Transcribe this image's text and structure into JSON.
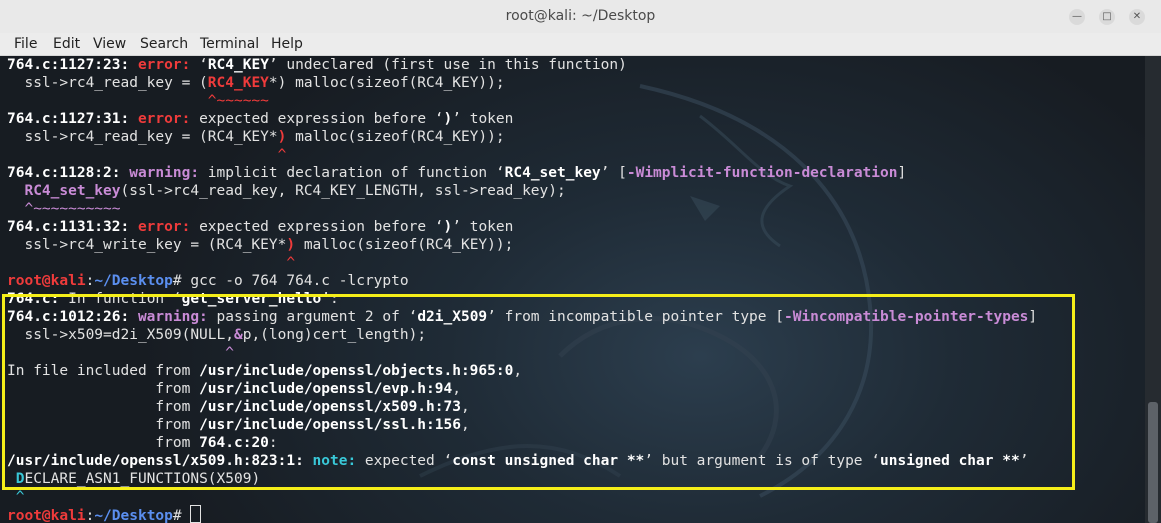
{
  "window": {
    "title": "root@kali: ~/Desktop",
    "minimize_icon": "minimize-icon",
    "maximize_icon": "maximize-icon",
    "close_icon": "close-icon"
  },
  "menu": [
    "File",
    "Edit",
    "View",
    "Search",
    "Terminal",
    "Help"
  ],
  "terminal": {
    "l1": {
      "loc": "764.c:1127:23:",
      "kind": "error:",
      "msg_a": " ‘",
      "sym": "RC4_KEY",
      "msg_b": "’ undeclared (first use in this function)"
    },
    "l2": {
      "a": "  ssl->rc4_read_key = (",
      "red": "RC4_KEY",
      "b": "*) malloc(sizeof(RC4_KEY));"
    },
    "l3": {
      "caret": "                       ^~~~~~~"
    },
    "l5": {
      "loc": "764.c:1127:31:",
      "kind": "error:",
      "msg_a": " expected expression before ‘",
      "sym": ")",
      "msg_b": "’ token"
    },
    "l6": {
      "a": "  ssl->rc4_read_key = (RC4_KEY*",
      "red": ")",
      "b": " malloc(sizeof(RC4_KEY));"
    },
    "l7": {
      "caret": "                               ^"
    },
    "l9": {
      "loc": "764.c:1128:2:",
      "kind": "warning:",
      "msg_a": " implicit declaration of function ‘",
      "sym": "RC4_set_key",
      "msg_b": "’ [",
      "flag": "-Wimplicit-function-declaration",
      "msg_c": "]"
    },
    "l10": {
      "a": "  ",
      "mag": "RC4_set_key",
      "b": "(ssl->rc4_read_key, RC4_KEY_LENGTH, ssl->read_key);"
    },
    "l11": {
      "caret": "  ^~~~~~~~~~~"
    },
    "l13": {
      "loc": "764.c:1131:32:",
      "kind": "error:",
      "msg_a": " expected expression before ‘",
      "sym": ")",
      "msg_b": "’ token"
    },
    "l14": {
      "a": "  ssl->rc4_write_key = (RC4_KEY*",
      "red": ")",
      "b": " malloc(sizeof(RC4_KEY));"
    },
    "l15": {
      "caret": "                                ^"
    },
    "l17": {
      "user": "root@kali",
      "colon": ":",
      "path": "~/Desktop",
      "hash": "# ",
      "cmd": "gcc -o 764 764.c -lcrypto"
    },
    "l18": {
      "loc": "764.c:",
      "msg_a": " In function ‘",
      "sym": "get_server_hello",
      "msg_b": "’:"
    },
    "l19": {
      "loc": "764.c:1012:26:",
      "kind": "warning:",
      "msg_a": " passing argument 2 of ‘",
      "sym": "d2i_X509",
      "msg_b": "’ from incompatible pointer type [",
      "flag": "-Wincompatible-pointer-types",
      "msg_c": "]"
    },
    "l20": {
      "a": "  ssl->x509=d2i_X509(NULL,",
      "mag": "&",
      "b": "p,(long)cert_length);"
    },
    "l21": {
      "caret": "                         ^"
    },
    "l23": {
      "a": "In file included from ",
      "file": "/usr/include/openssl/objects.h:965:0",
      "b": ","
    },
    "l24": {
      "a": "                 from ",
      "file": "/usr/include/openssl/evp.h:94",
      "b": ","
    },
    "l25": {
      "a": "                 from ",
      "file": "/usr/include/openssl/x509.h:73",
      "b": ","
    },
    "l26": {
      "a": "                 from ",
      "file": "/usr/include/openssl/ssl.h:156",
      "b": ","
    },
    "l27": {
      "a": "                 from ",
      "file": "764.c:20",
      "b": ":"
    },
    "l28": {
      "loc": "/usr/include/openssl/x509.h:823:1:",
      "kind": "note:",
      "msg_a": " expected ‘",
      "sym": "const unsigned char **",
      "msg_b": "’ but argument is of type ‘",
      "sym2": "unsigned char **",
      "msg_c": "’"
    },
    "l29": {
      "a": " ",
      "note": "D",
      "b": "ECLARE_ASN1_FUNCTIONS(X509)"
    },
    "l30": {
      "caret": " ^"
    },
    "l31": {
      "user": "root@kali",
      "colon": ":",
      "path": "~/Desktop",
      "hash": "# "
    }
  },
  "colors": {
    "error": "#ef3b3b",
    "warning": "#c98bd6",
    "note": "#39c8d8",
    "prompt_path": "#5b8ff0",
    "highlight_box": "#f5ee19"
  }
}
